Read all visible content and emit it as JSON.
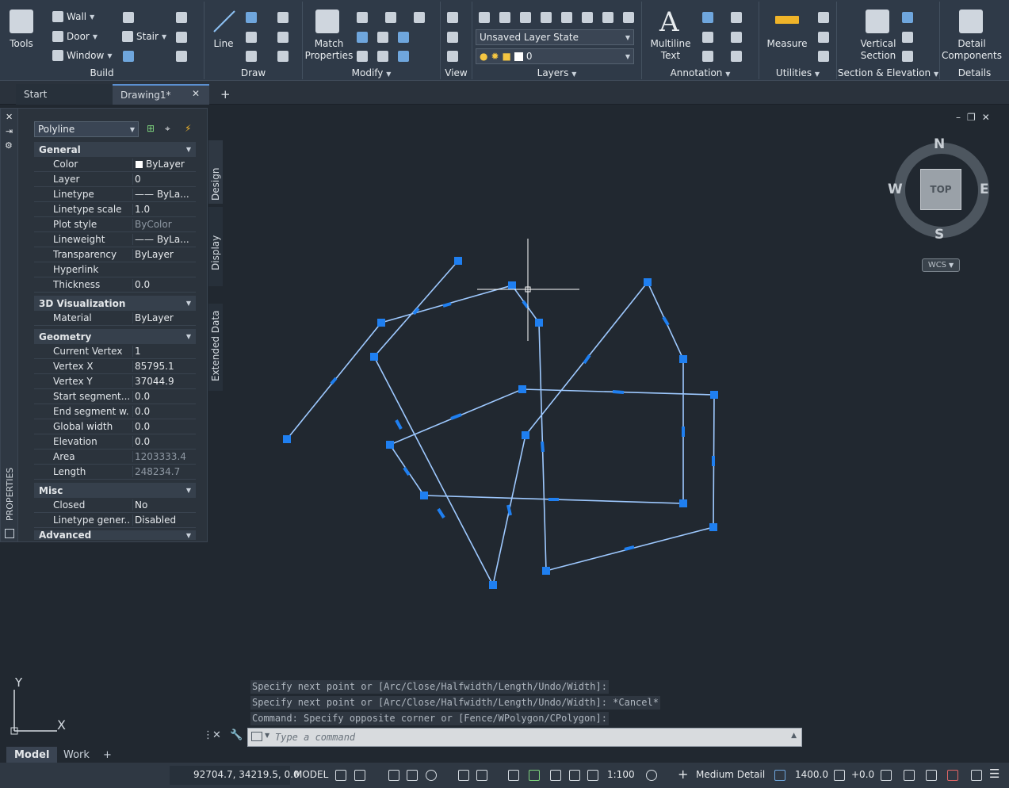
{
  "ribbon": {
    "panels": {
      "build": "Build",
      "draw": "Draw",
      "modify": "Modify",
      "view": "View",
      "layers": "Layers",
      "annotation": "Annotation",
      "utilities": "Utilities",
      "section_elevation": "Section & Elevation",
      "details": "Details"
    },
    "tools_label": "Tools",
    "build_items": [
      "Wall",
      "Door",
      "Window",
      "Stair"
    ],
    "line_label": "Line",
    "match_properties": "Match\nProperties",
    "layer_state": "Unsaved Layer State",
    "current_layer": "0",
    "multiline_text": "Multiline\nText",
    "measure": "Measure",
    "vertical_section": "Vertical\nSection",
    "detail_components": "Detail\nComponents"
  },
  "tabs": {
    "start": "Start",
    "drawing": "Drawing1*",
    "add": "+"
  },
  "properties": {
    "object_type": "Polyline",
    "palette_title": "PROPERTIES",
    "side_tabs": [
      "Design",
      "Display",
      "Extended Data"
    ],
    "sections": {
      "general": "General",
      "viz3d": "3D Visualization",
      "geometry": "Geometry",
      "misc": "Misc",
      "advanced": "Advanced"
    },
    "general": [
      {
        "k": "Color",
        "v": "ByLayer"
      },
      {
        "k": "Layer",
        "v": "0"
      },
      {
        "k": "Linetype",
        "v": "—— ByLa..."
      },
      {
        "k": "Linetype scale",
        "v": "1.0"
      },
      {
        "k": "Plot style",
        "v": "ByColor"
      },
      {
        "k": "Lineweight",
        "v": "—— ByLa..."
      },
      {
        "k": "Transparency",
        "v": "ByLayer"
      },
      {
        "k": "Hyperlink",
        "v": ""
      },
      {
        "k": "Thickness",
        "v": "0.0"
      }
    ],
    "viz3d": [
      {
        "k": "Material",
        "v": "ByLayer"
      }
    ],
    "geometry": [
      {
        "k": "Current Vertex",
        "v": "1"
      },
      {
        "k": "Vertex X",
        "v": "85795.1"
      },
      {
        "k": "Vertex Y",
        "v": "37044.9"
      },
      {
        "k": "Start segment...",
        "v": "0.0"
      },
      {
        "k": "End segment w...",
        "v": "0.0"
      },
      {
        "k": "Global width",
        "v": "0.0"
      },
      {
        "k": "Elevation",
        "v": "0.0"
      },
      {
        "k": "Area",
        "v": "1203333.4"
      },
      {
        "k": "Length",
        "v": "248234.7"
      }
    ],
    "misc": [
      {
        "k": "Closed",
        "v": "No"
      },
      {
        "k": "Linetype gener...",
        "v": "Disabled"
      }
    ]
  },
  "viewcube": {
    "n": "N",
    "s": "S",
    "e": "E",
    "w": "W",
    "face": "TOP",
    "wcs": "WCS"
  },
  "ucs": {
    "x": "X",
    "y": "Y"
  },
  "command": {
    "history": [
      "Specify next point or [Arc/Close/Halfwidth/Length/Undo/Width]:",
      "Specify next point or [Arc/Close/Halfwidth/Length/Undo/Width]: *Cancel*",
      "Command: Specify opposite corner or [Fence/WPolygon/CPolygon]:"
    ],
    "placeholder": "Type a command"
  },
  "layout_tabs": [
    "Model",
    "Work",
    "+"
  ],
  "status": {
    "coords": "92704.7, 34219.5, 0.0",
    "space": "MODEL",
    "scale": "1:100",
    "detail": "Medium Detail",
    "cut_plane": "1400.0",
    "elev": "+0.0"
  },
  "colors": {
    "canvas": "#212830",
    "ribbon": "#2f3a48",
    "polyline": "#9ec9ff",
    "grip": "#1f7ff0"
  }
}
